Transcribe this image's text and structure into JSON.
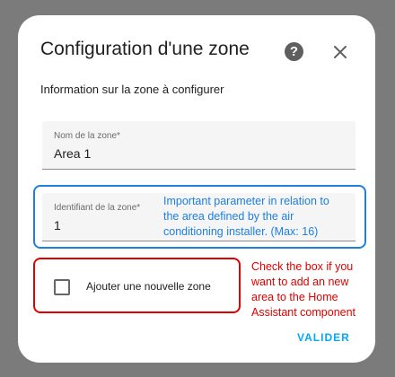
{
  "dialog": {
    "title": "Configuration d'une zone",
    "help_icon": "help-circle-icon",
    "help_glyph": "?",
    "close_icon": "close-icon",
    "subtitle": "Information sur la zone à configurer"
  },
  "fields": {
    "zone_name": {
      "label": "Nom de la zone*",
      "value": "Area 1"
    },
    "zone_id": {
      "label": "Identifiant de la zone*",
      "value": "1"
    }
  },
  "checkbox": {
    "label": "Ajouter une nouvelle zone",
    "checked": false
  },
  "actions": {
    "submit_label": "VALIDER"
  },
  "annotations": {
    "id_note_lines": [
      "Important parameter in relation to",
      "the area defined by the air",
      "conditioning installer. (Max: 16)"
    ],
    "checkbox_note_lines": [
      "Check the box if you",
      "want to add an new",
      "area to the Home",
      "Assistant component"
    ]
  },
  "colors": {
    "accent": "#03a9f4",
    "annotation_blue": "#1e7fe0",
    "annotation_red": "#e00000",
    "backdrop": "#7b7b7b"
  }
}
